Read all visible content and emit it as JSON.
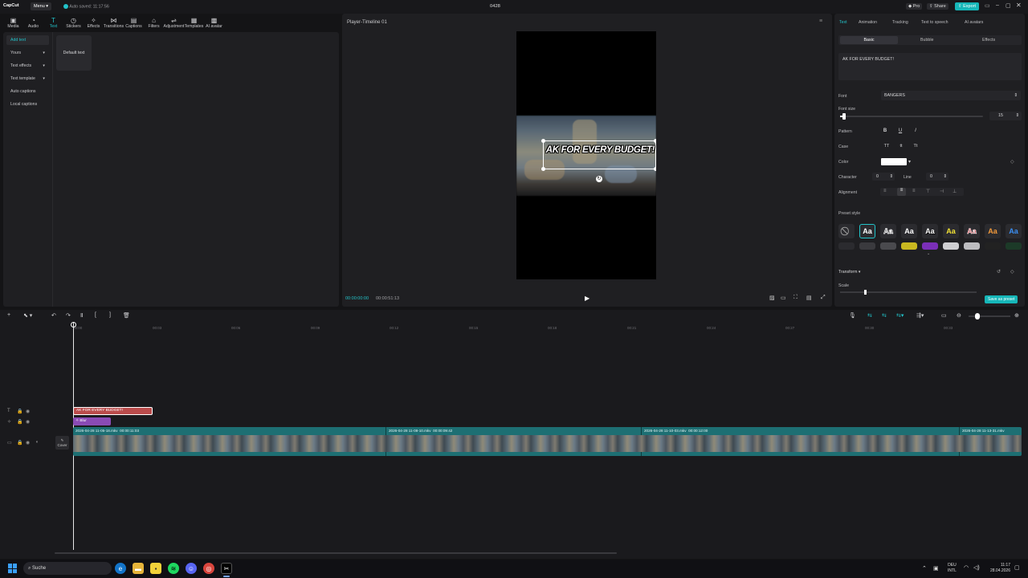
{
  "titlebar": {
    "logo": "CapCut",
    "menu": "Menu",
    "autosave": "Auto saved: 11:17:56",
    "project": "0428",
    "pro": "Pro",
    "share": "Share",
    "export": "Export"
  },
  "toolbar": [
    {
      "label": "Media",
      "icon": "media-icon"
    },
    {
      "label": "Audio",
      "icon": "audio-icon"
    },
    {
      "label": "Text",
      "icon": "text-icon"
    },
    {
      "label": "Stickers",
      "icon": "sticker-icon"
    },
    {
      "label": "Effects",
      "icon": "effects-icon"
    },
    {
      "label": "Transitions",
      "icon": "transitions-icon"
    },
    {
      "label": "Captions",
      "icon": "captions-icon"
    },
    {
      "label": "Filters",
      "icon": "filters-icon"
    },
    {
      "label": "Adjustment",
      "icon": "adjustment-icon"
    },
    {
      "label": "Templates",
      "icon": "templates-icon"
    },
    {
      "label": "AI avatar",
      "icon": "avatar-icon"
    }
  ],
  "leftnav": [
    "Add text",
    "Yours",
    "Text effects",
    "Text template",
    "Auto captions",
    "Local captions"
  ],
  "card": "Default text",
  "player": {
    "title": "Player-Timeline 01",
    "overlay_text": "AK FOR EVERY BUDGET!",
    "time_current": "00:00:00:00",
    "time_total": "00:00:51:13"
  },
  "rightpanel": {
    "tabs": [
      "Text",
      "Animation",
      "Tracking",
      "Text to speech",
      "AI avatars"
    ],
    "subtabs": [
      "Basic",
      "Bubble",
      "Effects"
    ],
    "text_value": "AK FOR EVERY BUDGET!",
    "font_label": "Font",
    "font_value": "BANGERS",
    "fontsize_label": "Font size",
    "fontsize_value": "15",
    "pattern_label": "Pattern",
    "pattern_b": "B",
    "pattern_u": "U",
    "pattern_i": "I",
    "case_label": "Case",
    "case_1": "TT",
    "case_2": "tt",
    "case_3": "Tt",
    "color_label": "Color",
    "character_label": "Character",
    "character_value": "0",
    "line_label": "Line",
    "line_value": "0",
    "alignment_label": "Alignment",
    "preset_label": "Preset style",
    "preset_text": "Aa",
    "transform_label": "Transform",
    "scale_label": "Scale",
    "save_preset": "Save as preset"
  },
  "timeline": {
    "ticks": [
      "00:00",
      "00:03",
      "00:06",
      "00:09",
      "00:12",
      "00:15",
      "00:18",
      "00:21",
      "00:24",
      "00:27",
      "00:30",
      "00:33"
    ],
    "text_clip": "AK FOR EVERY BUDGET!",
    "fx_clip": "Blur",
    "cover": "Cover",
    "video_clips": [
      "2026-04-28 11-05-18.mkv  00:00:11:03",
      "2026-04-28 11-08-10.mkv  00:00:09:42",
      "2026-04-28 11-10-03.mkv  00:00:12:00",
      "2026-04-28 11-13-31.mkv"
    ]
  },
  "taskbar": {
    "search": "Suche",
    "lang_1": "DEU",
    "lang_2": "INTL",
    "time": "11:17",
    "date": "28.04.2026"
  }
}
